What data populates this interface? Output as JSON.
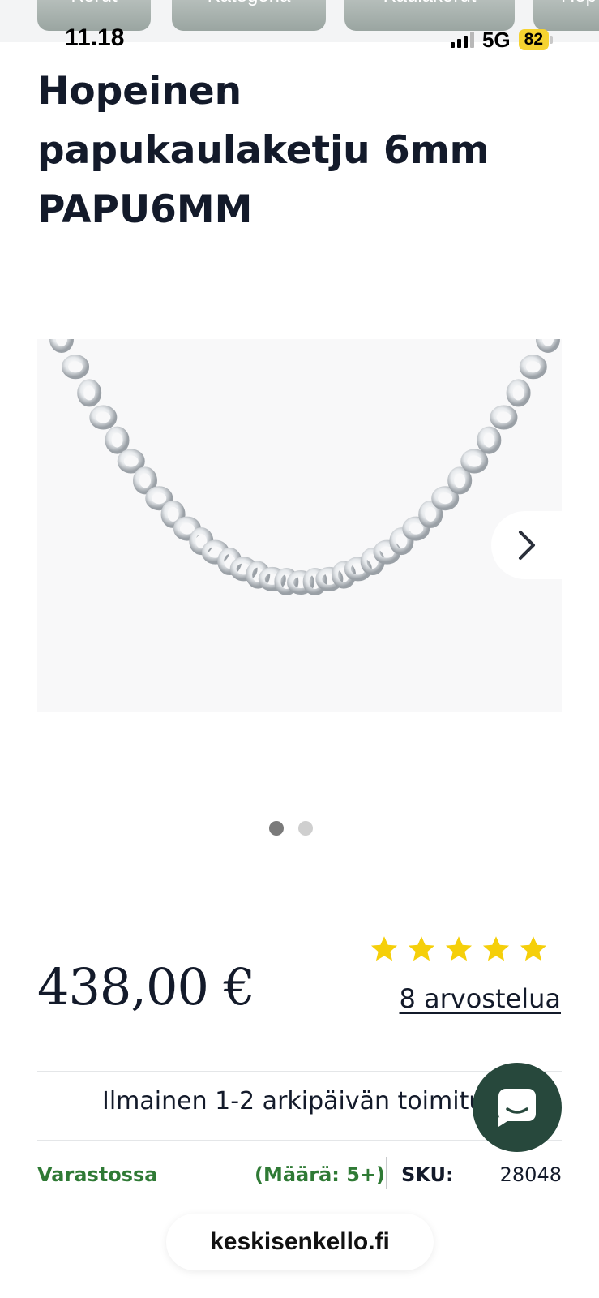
{
  "breadcrumbs": [
    "Korut",
    "Kategoria",
    "Kaulakorut",
    "Hop"
  ],
  "status_bar": {
    "time": "11.18",
    "network": "5G",
    "battery": "82"
  },
  "product": {
    "title": "Hopeinen papukaulaketju 6mm PAPU6MM",
    "price": "438,00 €",
    "rating_stars": 5,
    "reviews_label": "8 arvostelua",
    "shipping_text": "Ilmainen 1-2 arkipäivän toimitus",
    "stock_status": "Varastossa",
    "quantity": "(Määrä: 5+)",
    "sku_label": "SKU:",
    "sku_value": "28048"
  },
  "carousel": {
    "total": 2,
    "active_index": 0
  },
  "icons": {
    "next": "chevron-right-icon",
    "chat": "chat-icon",
    "star": "star-icon"
  },
  "colors": {
    "star": "#f5cf0a",
    "in_stock": "#2f7a35",
    "chat_button": "#27483c",
    "title": "#131a2a"
  },
  "browser": {
    "url": "keskisenkello.fi"
  }
}
